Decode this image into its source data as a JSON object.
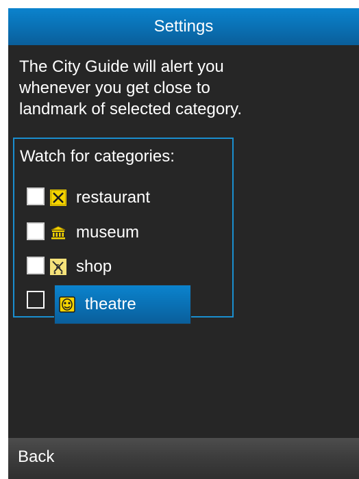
{
  "app": {
    "title": "Settings"
  },
  "description": {
    "lines": [
      "The City Guide will alert you",
      "whenever you get close to",
      "landmark of selected category."
    ]
  },
  "categories_group": {
    "label": "Watch for categories:",
    "items": [
      {
        "label": "restaurant",
        "icon": "restaurant-icon",
        "checked": false,
        "selected": false
      },
      {
        "label": "museum",
        "icon": "museum-icon",
        "checked": false,
        "selected": false
      },
      {
        "label": "shop",
        "icon": "shop-icon",
        "checked": false,
        "selected": false
      },
      {
        "label": "theatre",
        "icon": "theatre-icon",
        "checked": false,
        "selected": true
      }
    ]
  },
  "softkeys": {
    "left_label": "Back"
  },
  "colors": {
    "accent_blue": "#0a6fb2",
    "background": "#262626",
    "group_border": "#1a8fd0",
    "icon_yellow": "#f5d400"
  }
}
